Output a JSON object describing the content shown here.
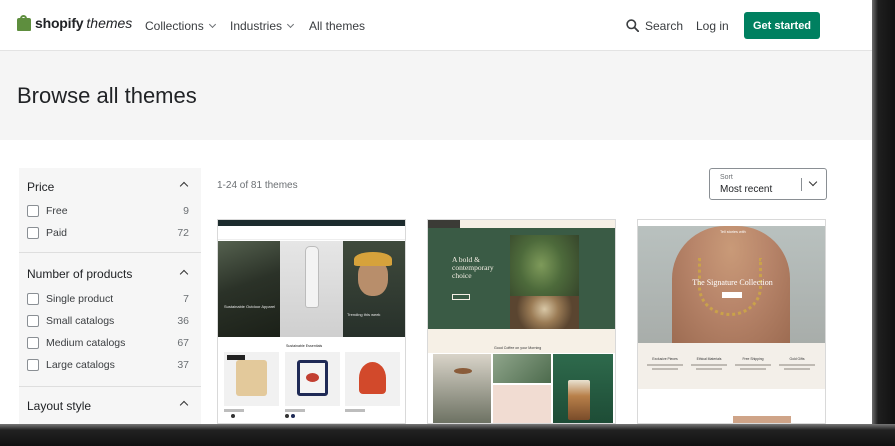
{
  "header": {
    "logo_bold": "shopify",
    "logo_italic": "themes",
    "nav": [
      {
        "label": "Collections",
        "has_dropdown": true
      },
      {
        "label": "Industries",
        "has_dropdown": true
      },
      {
        "label": "All themes",
        "has_dropdown": false
      }
    ],
    "search_label": "Search",
    "login_label": "Log in",
    "cta_label": "Get started",
    "cta_color": "#008060"
  },
  "hero": {
    "title": "Browse all themes"
  },
  "filters": {
    "price": {
      "title": "Price",
      "options": [
        {
          "label": "Free",
          "count": "9"
        },
        {
          "label": "Paid",
          "count": "72"
        }
      ]
    },
    "products": {
      "title": "Number of products",
      "options": [
        {
          "label": "Single product",
          "count": "7"
        },
        {
          "label": "Small catalogs",
          "count": "36"
        },
        {
          "label": "Medium catalogs",
          "count": "67"
        },
        {
          "label": "Large catalogs",
          "count": "37"
        }
      ]
    },
    "layout": {
      "title": "Layout style"
    }
  },
  "results": {
    "count_text": "1-24 of 81 themes"
  },
  "sort": {
    "label": "Sort",
    "value": "Most recent"
  },
  "themes": [
    {
      "icon": "dawn-theme-preview",
      "banner_left": "Sustainable Outdoor Apparel",
      "banner_right": "Trending this week",
      "section": "Sustainable Essentials"
    },
    {
      "icon": "green-coffee-theme-preview",
      "headline": "A bold & contemporary choice",
      "section": "Good Coffee on your Morning"
    },
    {
      "icon": "jewelry-theme-preview",
      "brand": "Tell stories with",
      "headline": "The Signature Collection",
      "features": [
        "Exclusive Pieces",
        "Ethical Materials",
        "Free Shipping",
        "Gold Gifts"
      ]
    }
  ]
}
